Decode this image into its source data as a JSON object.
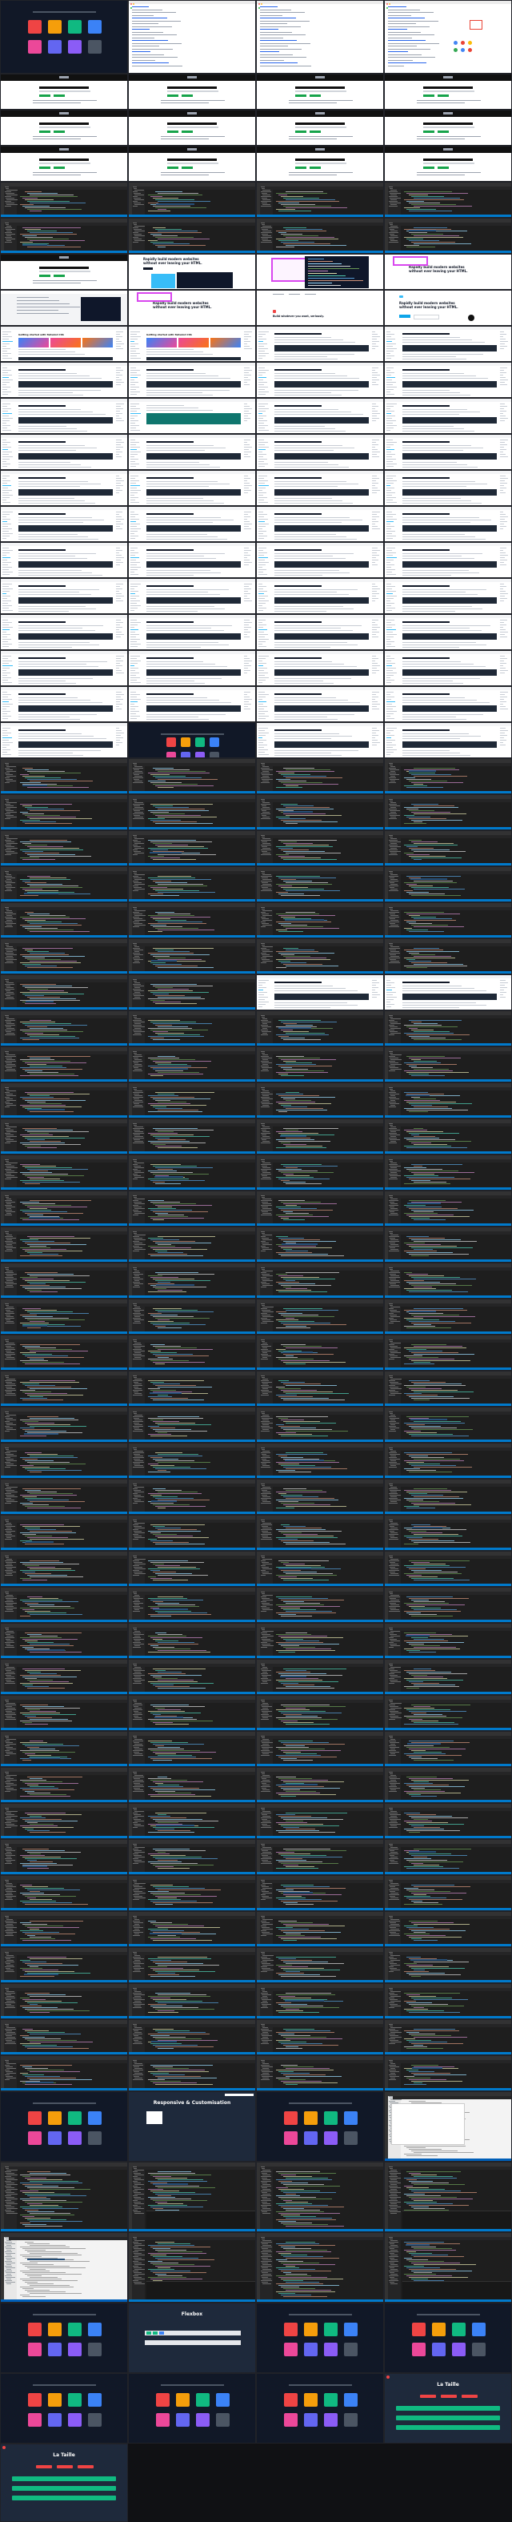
{
  "screenshot": {
    "description_free": true
  },
  "demo_page": {
    "heading": "Responsive & Customisation",
    "flexbox_heading": "Flexbox",
    "la_taille_heading": "La Taille",
    "tile_colors": [
      "#ef4444",
      "#f59e0b",
      "#10b981",
      "#3b82f6",
      "#ec4899",
      "#6366f1",
      "#8b5cf6",
      "#4b5563"
    ]
  },
  "landing": {
    "headline_line1": "Rapidly build modern websites",
    "headline_line2": "without ever leaving your HTML.",
    "build_whatever": "Build whatever you want, seriously."
  },
  "docs": {
    "getting_started": "Getting started with Tailwind CSS",
    "gradient_colors": [
      "#3b82f6",
      "#ec4899",
      "#f97316"
    ]
  },
  "theme": {
    "editor_bg": "#1e1e1e",
    "status_bar": "#007acc",
    "accent_green": "#16a34a",
    "accent_red": "#ef4444"
  }
}
